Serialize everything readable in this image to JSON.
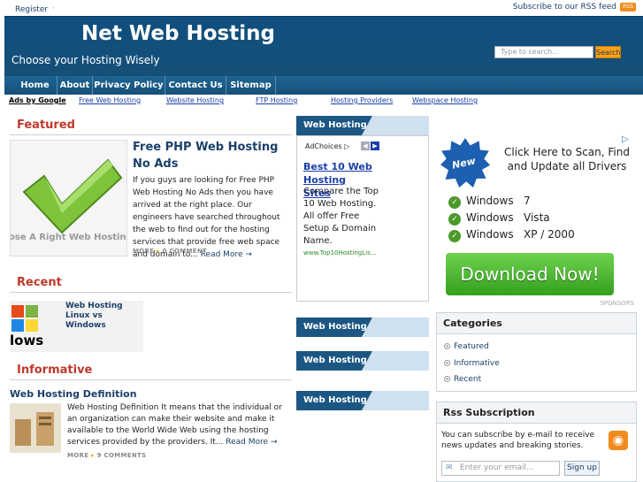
{
  "topbar": {
    "register": "Register",
    "rss_link": "Subscribe to our RSS feed",
    "rss_badge": "RSS"
  },
  "header": {
    "title": "Net Web Hosting",
    "tagline": "Choose your Hosting Wisely",
    "search_placeholder": "Type to search...",
    "search_button": "Search"
  },
  "nav": [
    "Home",
    "About",
    "Privacy Policy",
    "Contact Us",
    "Sitemap"
  ],
  "adlinks": {
    "label": "Ads by Google",
    "links": [
      "Free Web Hosting",
      "Website Hosting",
      "FTP Hosting",
      "Hosting Providers",
      "Webspace Hosting"
    ]
  },
  "featured": {
    "heading": "Featured",
    "image_caption": "ose A Right Web Hosting",
    "title": "Free PHP Web Hosting No Ads",
    "excerpt": "If you guys are looking for Free PHP Web Hosting No Ads then you have arrived at the right place. Our engineers have searched throughout the web to find out for the hosting services that provide free web space and domain to...",
    "read_more": "Read More →",
    "more": "MORE",
    "comments": "0 COMMENT"
  },
  "recent": {
    "heading": "Recent",
    "image_text": "lows",
    "title": "Web Hosting Linux vs Windows"
  },
  "informative": {
    "heading": "Informative",
    "title": "Web Hosting Definition",
    "excerpt": "Web Hosting Definition It means that the individual or an organization can make their website and make it available to the World Wide Web using the hosting services provided by the providers. It...",
    "read_more": "Read More →",
    "more": "MORE",
    "comments": "9 COMMENTS"
  },
  "middle": {
    "box_titles": [
      "Web Hosting",
      "Web Hosting",
      "Web Hosting",
      "Web Hosting"
    ],
    "ad": {
      "adchoices": "AdChoices ▷",
      "title": "Best 10 Web Hosting Sites",
      "body": "Compare the Top 10 Web Hosting. All offer Free Setup & Domain Name.",
      "url": "www.Top10HostingLis..."
    }
  },
  "banner": {
    "new_badge": "New",
    "headline": "Click Here to Scan, Find and Update all Drivers",
    "windows": [
      {
        "os": "Windows",
        "ver": "7"
      },
      {
        "os": "Windows",
        "ver": "Vista"
      },
      {
        "os": "Windows",
        "ver": "XP / 2000"
      }
    ],
    "download": "Download Now!",
    "sponsors": "SPONSORS"
  },
  "categories": {
    "title": "Categories",
    "items": [
      "Featured",
      "Informative",
      "Recent"
    ]
  },
  "rss": {
    "title": "Rss Subscription",
    "text": "You can subscribe by e-mail to receive news updates and breaking stories.",
    "email_placeholder": "Enter your email...",
    "signup": "Sign up"
  },
  "colors": {
    "header_bg": "#0f4f7e",
    "heading_red": "#c0392b",
    "link_blue": "#1b3f6a",
    "download_green": "#34a01e"
  }
}
